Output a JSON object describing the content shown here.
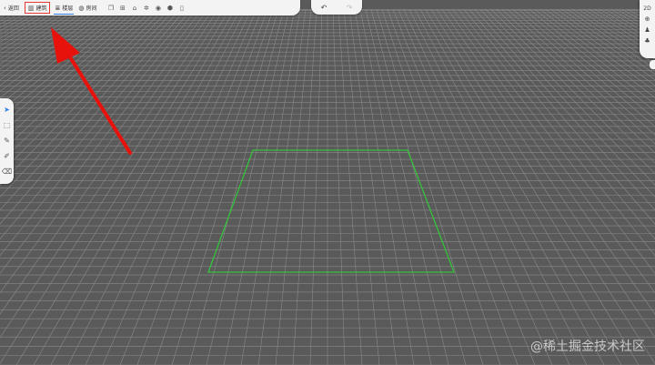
{
  "toolbar": {
    "back_label": "返回",
    "building_label": "建筑",
    "floor_label": "楼层",
    "room_label": "房间",
    "icons": [
      "copy-icon",
      "add-icon",
      "store-icon",
      "settings-icon",
      "eye-icon",
      "box-icon",
      "delete-icon"
    ]
  },
  "history": {
    "undo_icon": "undo-icon",
    "redo_icon": "redo-icon"
  },
  "view_panel": {
    "mode_label": "2D",
    "icons": [
      "compass-icon",
      "person-icon",
      "tree-icon"
    ]
  },
  "tools": [
    "select-arrow-icon",
    "box-select-icon",
    "pencil-icon",
    "edit-icon",
    "eraser-icon"
  ],
  "colors": {
    "grid_background": "#5a5a5a",
    "grid_line": "#8a8a8a",
    "selection_outline": "#35c23c",
    "annotation_arrow": "#e8120c",
    "accent": "#2f80ed"
  },
  "watermark": "@稀土掘金技术社区"
}
